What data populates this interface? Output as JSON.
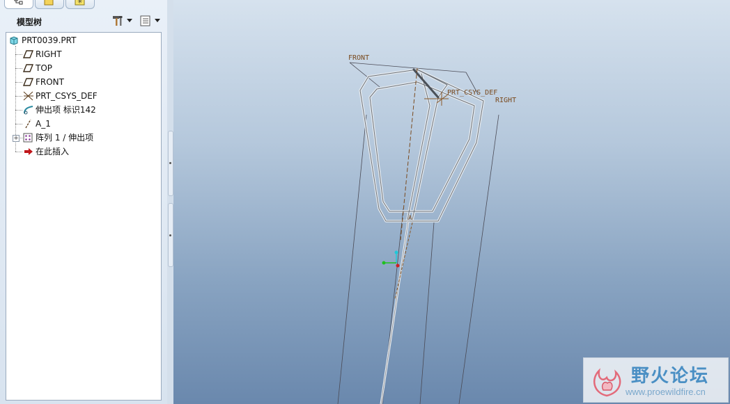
{
  "left_panel": {
    "title": "模型树",
    "header_buttons": [
      "tools-hammer-icon",
      "tree-filter-icon"
    ]
  },
  "model_tree": {
    "items": [
      {
        "label": "PRT0039.PRT",
        "icon": "part-icon"
      },
      {
        "label": "RIGHT",
        "icon": "datum-plane-icon"
      },
      {
        "label": "TOP",
        "icon": "datum-plane-icon"
      },
      {
        "label": "FRONT",
        "icon": "datum-plane-icon"
      },
      {
        "label": "PRT_CSYS_DEF",
        "icon": "coordinate-system-icon"
      },
      {
        "label": "伸出项 标识142",
        "icon": "protrusion-icon"
      },
      {
        "label": "A_1",
        "icon": "datum-axis-icon"
      },
      {
        "label": "阵列 1 / 伸出项",
        "icon": "pattern-icon"
      },
      {
        "label": "在此插入",
        "icon": "insert-here-arrow-icon"
      }
    ]
  },
  "viewport": {
    "labels": {
      "front": "FRONT",
      "csys": "PRT_CSYS_DEF",
      "right": "RIGHT",
      "axis": "A"
    }
  },
  "watermark": {
    "title": "野火论坛",
    "url": "www.proewildfire.cn"
  },
  "colors": {
    "datum_label": "#7a4a1e",
    "tree_bg": "#ffffff",
    "insert_arrow": "#c0161a"
  }
}
